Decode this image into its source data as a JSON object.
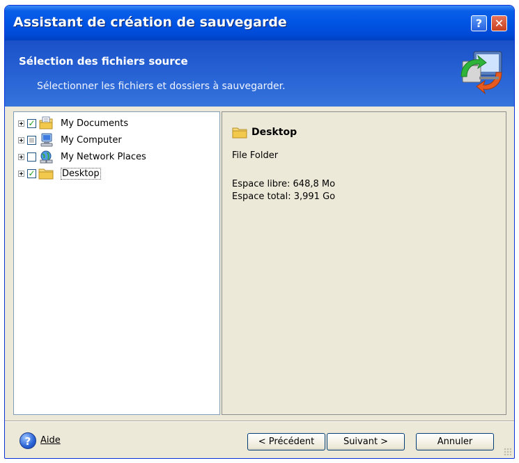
{
  "window": {
    "title": "Assistant de création de sauvegarde",
    "help_glyph": "?",
    "close_glyph": "✕"
  },
  "header": {
    "title": "Sélection des fichiers source",
    "subtitle": "Sélectionner les fichiers et dossiers à sauvegarder.",
    "icon": "backup-computer-icon"
  },
  "tree": {
    "items": [
      {
        "label": "My Documents",
        "check": "checked",
        "icon": "documents-folder-icon"
      },
      {
        "label": "My Computer",
        "check": "partial",
        "icon": "computer-icon"
      },
      {
        "label": "My Network Places",
        "check": "unchecked",
        "icon": "network-places-icon"
      },
      {
        "label": "Desktop",
        "check": "checked",
        "icon": "folder-icon",
        "selected": true
      }
    ]
  },
  "details": {
    "title": "Desktop",
    "type": "File Folder",
    "free_space": "Espace libre: 648,8 Mo",
    "total_space": "Espace total: 3,991 Go"
  },
  "footer": {
    "help_label": "Aide",
    "prev_label": "< Précédent",
    "next_label": "Suivant >",
    "cancel_label": "Annuler"
  },
  "colors": {
    "titlebar": "#0054e3",
    "header": "#2a66d6",
    "face": "#ece9d8"
  }
}
